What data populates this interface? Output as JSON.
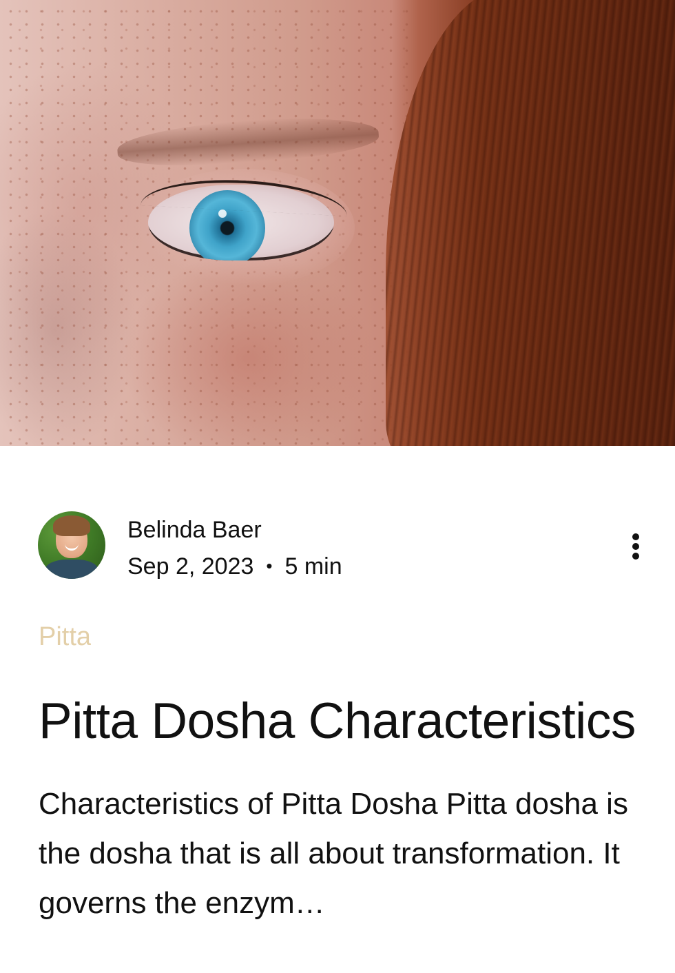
{
  "post": {
    "hero_image": "freckled-face-blue-eye-red-hair-photo",
    "author": {
      "name": "Belinda Baer",
      "avatar": "author-avatar-photo"
    },
    "date": "Sep 2, 2023",
    "separator": "•",
    "read_time": "5 min",
    "more_icon": "vertical-ellipsis-icon",
    "category": "Pitta",
    "title": "Pitta Dosha Characteristics",
    "excerpt": "Characteristics of Pitta Dosha Pitta dosha is the dosha that is all about transformation. It governs the enzym…"
  },
  "colors": {
    "category": "#e3cfa8",
    "text": "#111111",
    "background": "#ffffff"
  }
}
